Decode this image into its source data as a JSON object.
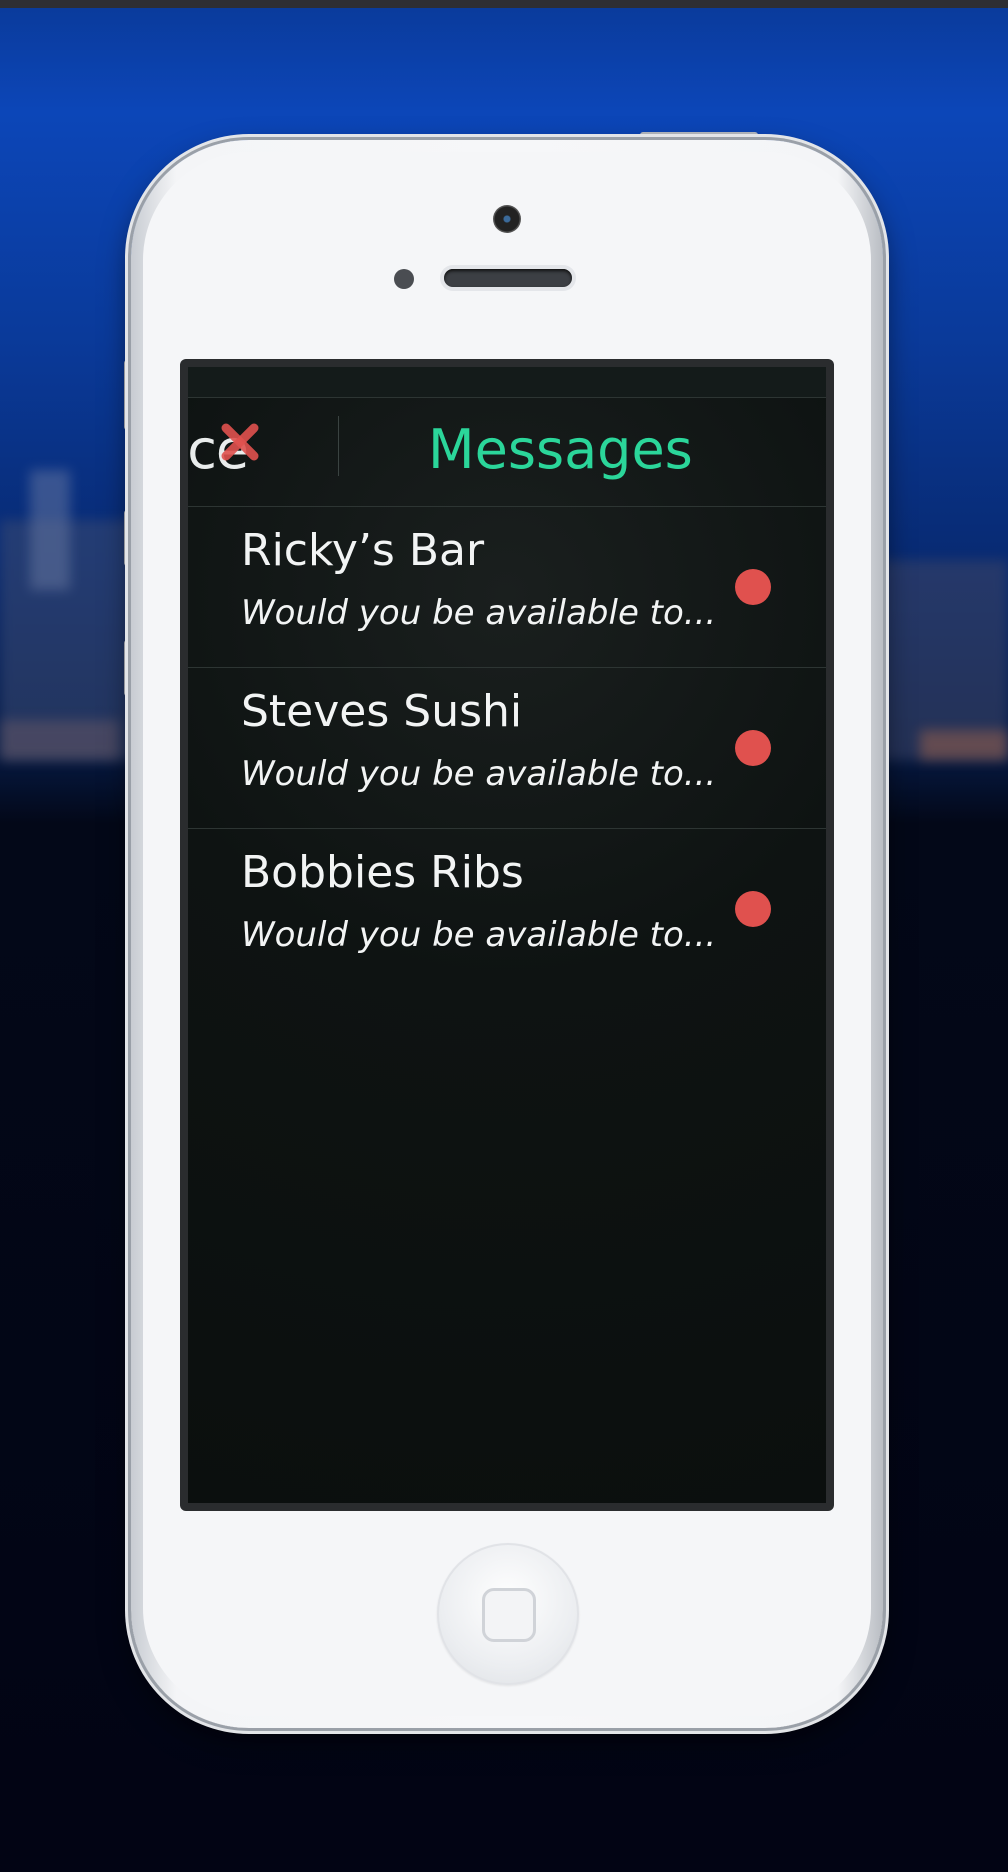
{
  "nav": {
    "prev_label": "nce",
    "title": "Messages"
  },
  "messages": [
    {
      "name": "Ricky’s Bar",
      "preview": "Would you be available to..."
    },
    {
      "name": "Steves Sushi",
      "preview": "Would you be available to..."
    },
    {
      "name": "Bobbies Ribs",
      "preview": "Would you be available to..."
    }
  ],
  "icons": {
    "close": "close-icon",
    "unread": "unread-dot-icon"
  },
  "colors": {
    "accent": "#2bd69a",
    "unread": "#e0514e",
    "close": "#e0514e",
    "screen_bg": "#0b0f0e"
  }
}
